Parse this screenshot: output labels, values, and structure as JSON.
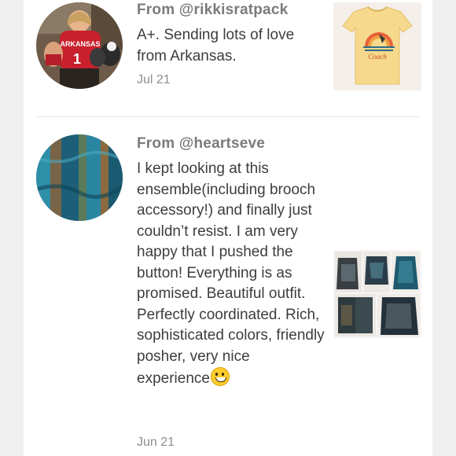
{
  "reviews": [
    {
      "author": "From @rikkisratpack",
      "text": "A+. Sending lots of love from Arkansas.",
      "date": "Jul 21",
      "jersey_text": "ARKANSAS",
      "jersey_number": "1",
      "shirt_print": "Coach"
    },
    {
      "author": "From @heartseve",
      "text": "I kept looking at this ensemble(including brooch accessory!) and finally just couldn’t resist. I am very happy that I pushed the button! Everything is as promised. Beautiful outfit. Perfectly coordinated. Rich, sophisticated colors, friendly posher, very nice experience",
      "emoji": "grinning-face-emoji",
      "date": "Jun 21"
    }
  ],
  "colors": {
    "author": "#7b7b7b",
    "text": "#3d3d3d",
    "date": "#8e8e8e",
    "background": "#f1f0f1",
    "card": "#ffffff"
  }
}
